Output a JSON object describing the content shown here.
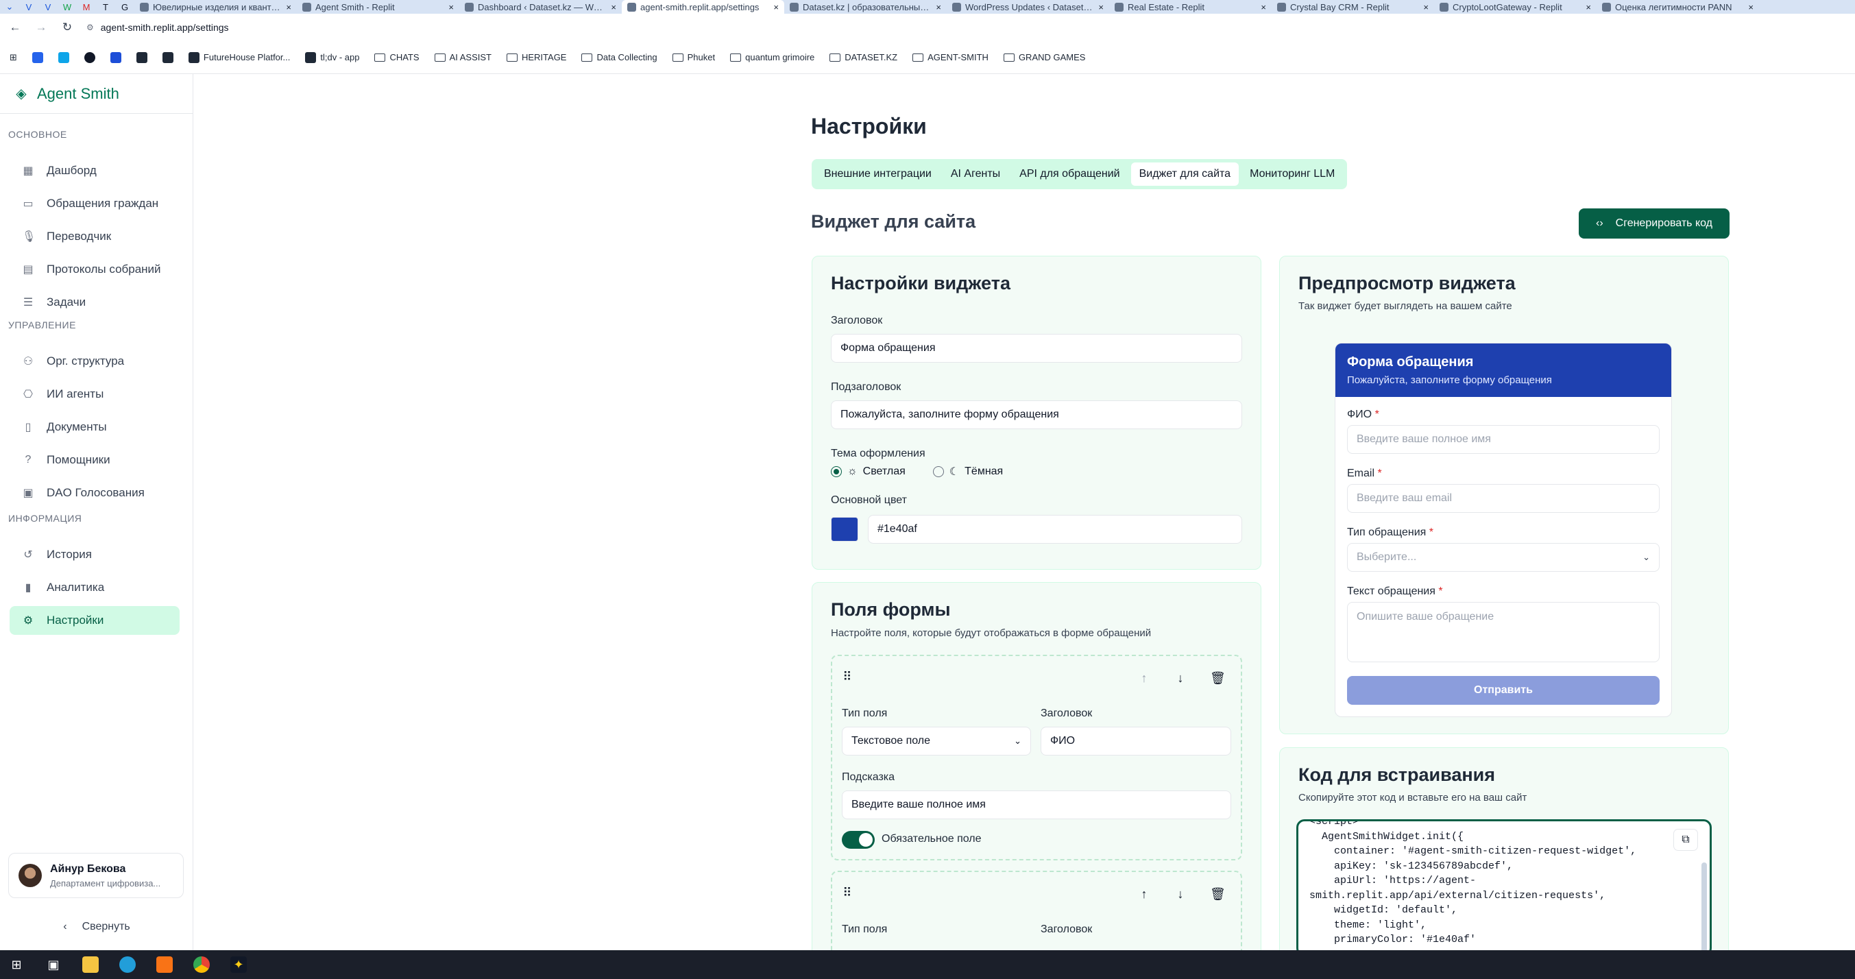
{
  "browser": {
    "pinned_tabs": [
      "V",
      "V",
      "W",
      "M",
      "T",
      "G"
    ],
    "tabs": [
      {
        "title": "Ювелирные изделия и квантов...",
        "active": false
      },
      {
        "title": "Agent Smith - Replit",
        "active": false
      },
      {
        "title": "Dashboard ‹ Dataset.kz — Wor...",
        "active": false
      },
      {
        "title": "agent-smith.replit.app/settings",
        "active": true
      },
      {
        "title": "Dataset.kz | образовательных ...",
        "active": false
      },
      {
        "title": "WordPress Updates ‹ Dataset.kz",
        "active": false
      },
      {
        "title": "Real Estate - Replit",
        "active": false
      },
      {
        "title": "Crystal Bay CRM - Replit",
        "active": false
      },
      {
        "title": "CryptoLootGateway - Replit",
        "active": false
      },
      {
        "title": "Оценка легитимности PANN",
        "active": false
      }
    ],
    "url": "agent-smith.replit.app/settings",
    "bookmarks": [
      {
        "label": "FutureHouse Platfor...",
        "type": "link"
      },
      {
        "label": "tl;dv - app",
        "type": "link"
      },
      {
        "label": "CHATS",
        "type": "folder"
      },
      {
        "label": "AI ASSIST",
        "type": "folder"
      },
      {
        "label": "HERITAGE",
        "type": "folder"
      },
      {
        "label": "Data Collecting",
        "type": "folder"
      },
      {
        "label": "Phuket",
        "type": "folder"
      },
      {
        "label": "quantum grimoire",
        "type": "folder"
      },
      {
        "label": "DATASET.KZ",
        "type": "folder"
      },
      {
        "label": "AGENT-SMITH",
        "type": "folder"
      },
      {
        "label": "GRAND GAMES",
        "type": "folder"
      }
    ]
  },
  "app": {
    "name": "Agent Smith"
  },
  "sidebar": {
    "sections": [
      {
        "title": "ОСНОВНОЕ",
        "items": [
          {
            "label": "Дашборд",
            "icon": "dashboard-icon"
          },
          {
            "label": "Обращения граждан",
            "icon": "message-icon"
          },
          {
            "label": "Переводчик",
            "icon": "mic-icon"
          },
          {
            "label": "Протоколы собраний",
            "icon": "calendar-icon"
          },
          {
            "label": "Задачи",
            "icon": "tasks-icon"
          }
        ]
      },
      {
        "title": "УПРАВЛЕНИЕ",
        "items": [
          {
            "label": "Орг. структура",
            "icon": "users-icon"
          },
          {
            "label": "ИИ агенты",
            "icon": "bot-icon"
          },
          {
            "label": "Документы",
            "icon": "file-icon"
          },
          {
            "label": "Помощники",
            "icon": "help-icon"
          },
          {
            "label": "DAO Голосования",
            "icon": "vote-icon"
          }
        ]
      },
      {
        "title": "ИНФОРМАЦИЯ",
        "items": [
          {
            "label": "История",
            "icon": "history-icon"
          },
          {
            "label": "Аналитика",
            "icon": "chart-icon"
          },
          {
            "label": "Настройки",
            "icon": "gear-icon",
            "active": true
          }
        ]
      }
    ],
    "user": {
      "name": "Айнур Бекова",
      "department": "Департамент цифровиза..."
    },
    "collapse_label": "Свернуть"
  },
  "page": {
    "title": "Настройки",
    "tabs": [
      {
        "label": "Внешние интеграции",
        "active": false
      },
      {
        "label": "AI Агенты",
        "active": false
      },
      {
        "label": "API для обращений",
        "active": false
      },
      {
        "label": "Виджет для сайта",
        "active": true
      },
      {
        "label": "Мониторинг LLM",
        "active": false
      }
    ],
    "section_title": "Виджет для сайта",
    "generate_button": "Сгенерировать код"
  },
  "widget_settings": {
    "title": "Настройки виджета",
    "header_label": "Заголовок",
    "header_value": "Форма обращения",
    "subheader_label": "Подзаголовок",
    "subheader_value": "Пожалуйста, заполните форму обращения",
    "theme_label": "Тема оформления",
    "theme_light": "Светлая",
    "theme_dark": "Тёмная",
    "theme_selected": "light",
    "color_label": "Основной цвет",
    "color_value": "#1e40af"
  },
  "form_fields": {
    "title": "Поля формы",
    "subtitle": "Настройте поля, которые будут отображаться в форме обращений",
    "fields": [
      {
        "type_label": "Тип поля",
        "type_value": "Текстовое поле",
        "header_label": "Заголовок",
        "header_value": "ФИО",
        "hint_label": "Подсказка",
        "hint_value": "Введите ваше полное имя",
        "required_label": "Обязательное поле",
        "required": true
      },
      {
        "type_label": "Тип поля",
        "header_label": "Заголовок"
      }
    ]
  },
  "preview": {
    "title": "Предпросмотр виджета",
    "subtitle": "Так виджет будет выглядеть на вашем сайте",
    "form_title": "Форма обращения",
    "form_subtitle": "Пожалуйста, заполните форму обращения",
    "fio_label": "ФИО",
    "fio_placeholder": "Введите ваше полное имя",
    "email_label": "Email",
    "email_placeholder": "Введите ваш email",
    "type_label": "Тип обращения",
    "type_placeholder": "Выберите...",
    "text_label": "Текст обращения",
    "text_placeholder": "Опишите ваше обращение",
    "submit_label": "Отправить",
    "required_mark": "*"
  },
  "embed": {
    "title": "Код для встраивания",
    "subtitle": "Скопируйте этот код и вставьте его на ваш сайт",
    "code_top_fragment": "<script>",
    "code": "  AgentSmithWidget.init({\n    container: '#agent-smith-citizen-request-widget',\n    apiKey: 'sk-123456789abcdef',\n    apiUrl: 'https://agent-smith.replit.app/api/external/citizen-requests',\n    widgetId: 'default',\n    theme: 'light',\n    primaryColor: '#1e40af'"
  },
  "colors": {
    "brand": "#047857",
    "primary_button": "#065f46",
    "tab_bar": "#d1fae5",
    "widget_primary": "#1e40af",
    "submit_disabled": "#8b9ddc"
  }
}
